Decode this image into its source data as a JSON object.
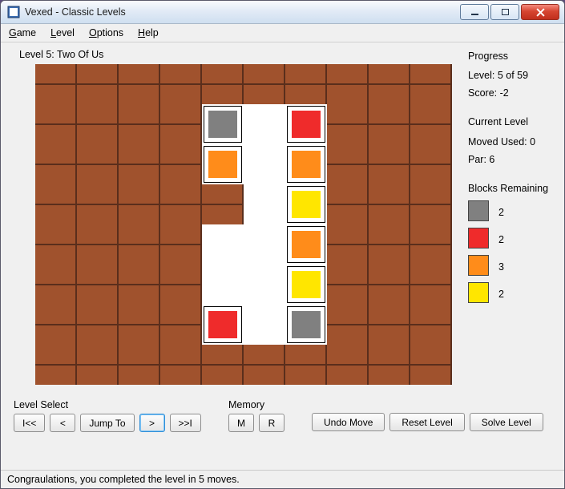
{
  "window": {
    "title": "Vexed - Classic Levels"
  },
  "menu": {
    "game": "Game",
    "level": "Level",
    "options": "Options",
    "help": "Help"
  },
  "level": {
    "label": "Level 5: Two Of Us"
  },
  "progress": {
    "heading": "Progress",
    "level_label": "Level: 5 of 59",
    "score_label": "Score: -2"
  },
  "current": {
    "heading": "Current Level",
    "moves_label": "Moved Used: 0",
    "par_label": "Par: 6"
  },
  "remaining": {
    "heading": "Blocks Remaining",
    "items": [
      {
        "color": "#808080",
        "count": "2"
      },
      {
        "color": "#ef2b2b",
        "count": "2"
      },
      {
        "color": "#ff8c1a",
        "count": "3"
      },
      {
        "color": "#ffe600",
        "count": "2"
      }
    ]
  },
  "levelselect": {
    "heading": "Level Select",
    "first": "I<<",
    "prev": "<",
    "jump": "Jump To",
    "next": ">",
    "last": ">>I"
  },
  "memory": {
    "heading": "Memory",
    "m": "M",
    "r": "R"
  },
  "actions": {
    "undo": "Undo Move",
    "reset": "Reset Level",
    "solve": "Solve Level"
  },
  "status": {
    "text": "Congraulations, you completed the level in 5 moves."
  },
  "board": {
    "cols": 10,
    "rows": 8,
    "cells": [
      "B",
      "B",
      "B",
      "B",
      "B",
      "B",
      "B",
      "B",
      "B",
      "B",
      "B",
      "B",
      "B",
      "B",
      "gray",
      "E",
      "red",
      "B",
      "B",
      "B",
      "B",
      "B",
      "B",
      "B",
      "orange",
      "E",
      "orange",
      "B",
      "B",
      "B",
      "B",
      "B",
      "B",
      "B",
      "B",
      "E",
      "yellow",
      "B",
      "B",
      "B",
      "B",
      "B",
      "B",
      "B",
      "E",
      "E",
      "orange",
      "B",
      "B",
      "B",
      "B",
      "B",
      "B",
      "B",
      "E",
      "E",
      "yellow",
      "B",
      "B",
      "B",
      "B",
      "B",
      "B",
      "B",
      "red",
      "E",
      "gray",
      "B",
      "B",
      "B",
      "B",
      "B",
      "B",
      "B",
      "B",
      "B",
      "B",
      "B",
      "B",
      "B"
    ]
  },
  "colors": {
    "gray": "#808080",
    "red": "#ef2b2b",
    "orange": "#ff8c1a",
    "yellow": "#ffe600"
  }
}
